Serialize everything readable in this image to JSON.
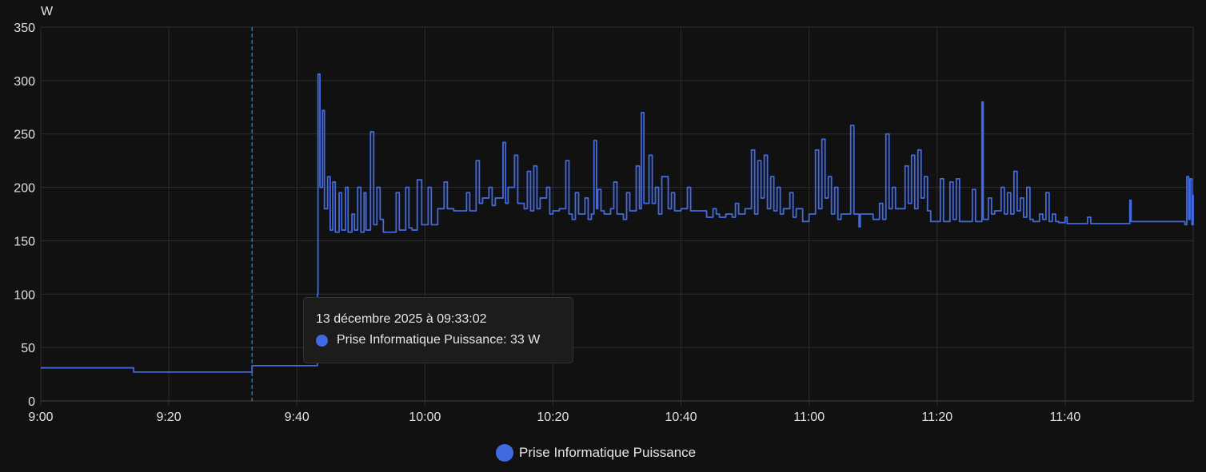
{
  "chart_data": {
    "type": "line",
    "title": "",
    "ylabel": "W",
    "xlabel": "",
    "ylim": [
      0,
      350
    ],
    "xlim_minutes_from_9": [
      0,
      180
    ],
    "yticks": [
      "0",
      "50",
      "100",
      "150",
      "200",
      "250",
      "300",
      "350"
    ],
    "xticks": [
      {
        "m": 0,
        "label": "9:00"
      },
      {
        "m": 20,
        "label": "9:20"
      },
      {
        "m": 40,
        "label": "9:40"
      },
      {
        "m": 60,
        "label": "10:00"
      },
      {
        "m": 80,
        "label": "10:20"
      },
      {
        "m": 100,
        "label": "10:40"
      },
      {
        "m": 120,
        "label": "11:00"
      },
      {
        "m": 140,
        "label": "11:20"
      },
      {
        "m": 160,
        "label": "11:40"
      }
    ],
    "grid": true,
    "legend_position": "bottom-center",
    "series": [
      {
        "name": "Prise Informatique Puissance",
        "color": "#4169e1",
        "step": true,
        "points_minutes_from_9_00": [
          [
            0,
            31
          ],
          [
            14.5,
            27
          ],
          [
            33,
            33
          ],
          [
            43.2,
            100
          ],
          [
            43.3,
            306
          ],
          [
            43.6,
            200
          ],
          [
            44,
            272
          ],
          [
            44.3,
            180
          ],
          [
            44.8,
            210
          ],
          [
            45.2,
            160
          ],
          [
            45.6,
            205
          ],
          [
            46,
            158
          ],
          [
            46.6,
            195
          ],
          [
            47,
            160
          ],
          [
            47.6,
            200
          ],
          [
            48,
            158
          ],
          [
            48.6,
            175
          ],
          [
            49,
            160
          ],
          [
            49.5,
            200
          ],
          [
            50,
            158
          ],
          [
            50.5,
            195
          ],
          [
            50.8,
            160
          ],
          [
            51.5,
            252
          ],
          [
            52,
            165
          ],
          [
            52.5,
            200
          ],
          [
            53,
            170
          ],
          [
            53.5,
            158
          ],
          [
            55,
            158
          ],
          [
            55.5,
            195
          ],
          [
            56,
            160
          ],
          [
            57,
            200
          ],
          [
            57.5,
            162
          ],
          [
            58,
            160
          ],
          [
            58.8,
            207
          ],
          [
            59.5,
            165
          ],
          [
            60,
            165
          ],
          [
            60.5,
            200
          ],
          [
            61,
            165
          ],
          [
            62,
            180
          ],
          [
            63,
            205
          ],
          [
            63.5,
            180
          ],
          [
            64.5,
            178
          ],
          [
            66,
            178
          ],
          [
            66.5,
            195
          ],
          [
            67,
            178
          ],
          [
            68,
            225
          ],
          [
            68.5,
            185
          ],
          [
            69,
            190
          ],
          [
            70,
            200
          ],
          [
            70.5,
            183
          ],
          [
            71,
            190
          ],
          [
            72.2,
            242
          ],
          [
            72.6,
            185
          ],
          [
            73,
            200
          ],
          [
            74,
            230
          ],
          [
            74.5,
            185
          ],
          [
            75.5,
            180
          ],
          [
            76,
            215
          ],
          [
            76.5,
            178
          ],
          [
            77,
            220
          ],
          [
            77.5,
            180
          ],
          [
            78,
            190
          ],
          [
            79,
            200
          ],
          [
            79.5,
            175
          ],
          [
            80,
            178
          ],
          [
            81,
            180
          ],
          [
            82,
            225
          ],
          [
            82.5,
            175
          ],
          [
            83,
            170
          ],
          [
            83.5,
            195
          ],
          [
            84,
            175
          ],
          [
            85,
            190
          ],
          [
            85.5,
            170
          ],
          [
            86,
            175
          ],
          [
            86.4,
            244
          ],
          [
            86.8,
            180
          ],
          [
            87,
            198
          ],
          [
            87.5,
            178
          ],
          [
            88,
            175
          ],
          [
            89,
            180
          ],
          [
            89.5,
            205
          ],
          [
            90,
            175
          ],
          [
            91,
            170
          ],
          [
            91.5,
            195
          ],
          [
            92,
            178
          ],
          [
            93,
            220
          ],
          [
            93.5,
            180
          ],
          [
            93.8,
            270
          ],
          [
            94.2,
            185
          ],
          [
            95,
            230
          ],
          [
            95.5,
            185
          ],
          [
            96,
            200
          ],
          [
            96.5,
            175
          ],
          [
            97,
            210
          ],
          [
            98,
            180
          ],
          [
            98.5,
            195
          ],
          [
            99,
            178
          ],
          [
            100,
            180
          ],
          [
            101,
            200
          ],
          [
            101.5,
            178
          ],
          [
            103,
            178
          ],
          [
            104,
            172
          ],
          [
            105,
            180
          ],
          [
            105.5,
            175
          ],
          [
            106,
            172
          ],
          [
            107,
            175
          ],
          [
            108,
            172
          ],
          [
            108.5,
            185
          ],
          [
            109,
            175
          ],
          [
            110,
            180
          ],
          [
            111,
            235
          ],
          [
            111.5,
            175
          ],
          [
            112,
            225
          ],
          [
            112.5,
            190
          ],
          [
            113,
            230
          ],
          [
            113.5,
            180
          ],
          [
            114,
            210
          ],
          [
            114.5,
            178
          ],
          [
            115,
            200
          ],
          [
            115.5,
            175
          ],
          [
            116,
            180
          ],
          [
            117,
            195
          ],
          [
            117.5,
            172
          ],
          [
            118,
            180
          ],
          [
            119,
            168
          ],
          [
            120,
            175
          ],
          [
            121,
            235
          ],
          [
            121.5,
            180
          ],
          [
            122,
            245
          ],
          [
            122.5,
            190
          ],
          [
            123,
            210
          ],
          [
            123.5,
            175
          ],
          [
            124,
            200
          ],
          [
            124.5,
            170
          ],
          [
            125,
            175
          ],
          [
            126.5,
            258
          ],
          [
            127,
            175
          ],
          [
            127.8,
            163
          ],
          [
            128,
            175
          ],
          [
            130,
            170
          ],
          [
            131,
            185
          ],
          [
            131.5,
            170
          ],
          [
            132,
            250
          ],
          [
            132.5,
            180
          ],
          [
            133,
            200
          ],
          [
            133.5,
            180
          ],
          [
            135,
            220
          ],
          [
            135.5,
            185
          ],
          [
            136,
            230
          ],
          [
            136.5,
            180
          ],
          [
            137,
            235
          ],
          [
            137.5,
            190
          ],
          [
            138,
            210
          ],
          [
            138.5,
            178
          ],
          [
            139,
            168
          ],
          [
            140.5,
            208
          ],
          [
            141,
            168
          ],
          [
            142,
            205
          ],
          [
            142.5,
            170
          ],
          [
            143,
            208
          ],
          [
            143.5,
            168
          ],
          [
            145.5,
            198
          ],
          [
            146,
            168
          ],
          [
            147,
            280
          ],
          [
            147.2,
            170
          ],
          [
            148,
            190
          ],
          [
            148.5,
            175
          ],
          [
            149,
            178
          ],
          [
            150,
            200
          ],
          [
            150.5,
            175
          ],
          [
            151,
            195
          ],
          [
            151.5,
            175
          ],
          [
            152,
            215
          ],
          [
            152.5,
            178
          ],
          [
            153,
            190
          ],
          [
            153.5,
            172
          ],
          [
            154,
            200
          ],
          [
            154.5,
            170
          ],
          [
            155,
            168
          ],
          [
            156,
            175
          ],
          [
            156.5,
            170
          ],
          [
            157,
            195
          ],
          [
            157.5,
            168
          ],
          [
            158,
            175
          ],
          [
            158.5,
            168
          ],
          [
            159,
            167
          ],
          [
            160,
            172
          ],
          [
            160.3,
            166
          ],
          [
            163.5,
            172
          ],
          [
            164,
            166
          ],
          [
            170,
            166
          ],
          [
            170.1,
            188
          ],
          [
            170.3,
            168
          ],
          [
            178.5,
            168
          ],
          [
            178.7,
            165
          ],
          [
            179,
            210
          ],
          [
            179.3,
            170
          ],
          [
            179.5,
            208
          ],
          [
            179.8,
            165
          ],
          [
            180,
            193
          ]
        ]
      }
    ],
    "hover_marker_minute": 33
  },
  "tooltip": {
    "title": "13 décembre 2025 à 09:33:02",
    "series_line": "Prise Informatique Puissance: 33 W"
  },
  "legend": {
    "label": "Prise Informatique Puissance"
  }
}
